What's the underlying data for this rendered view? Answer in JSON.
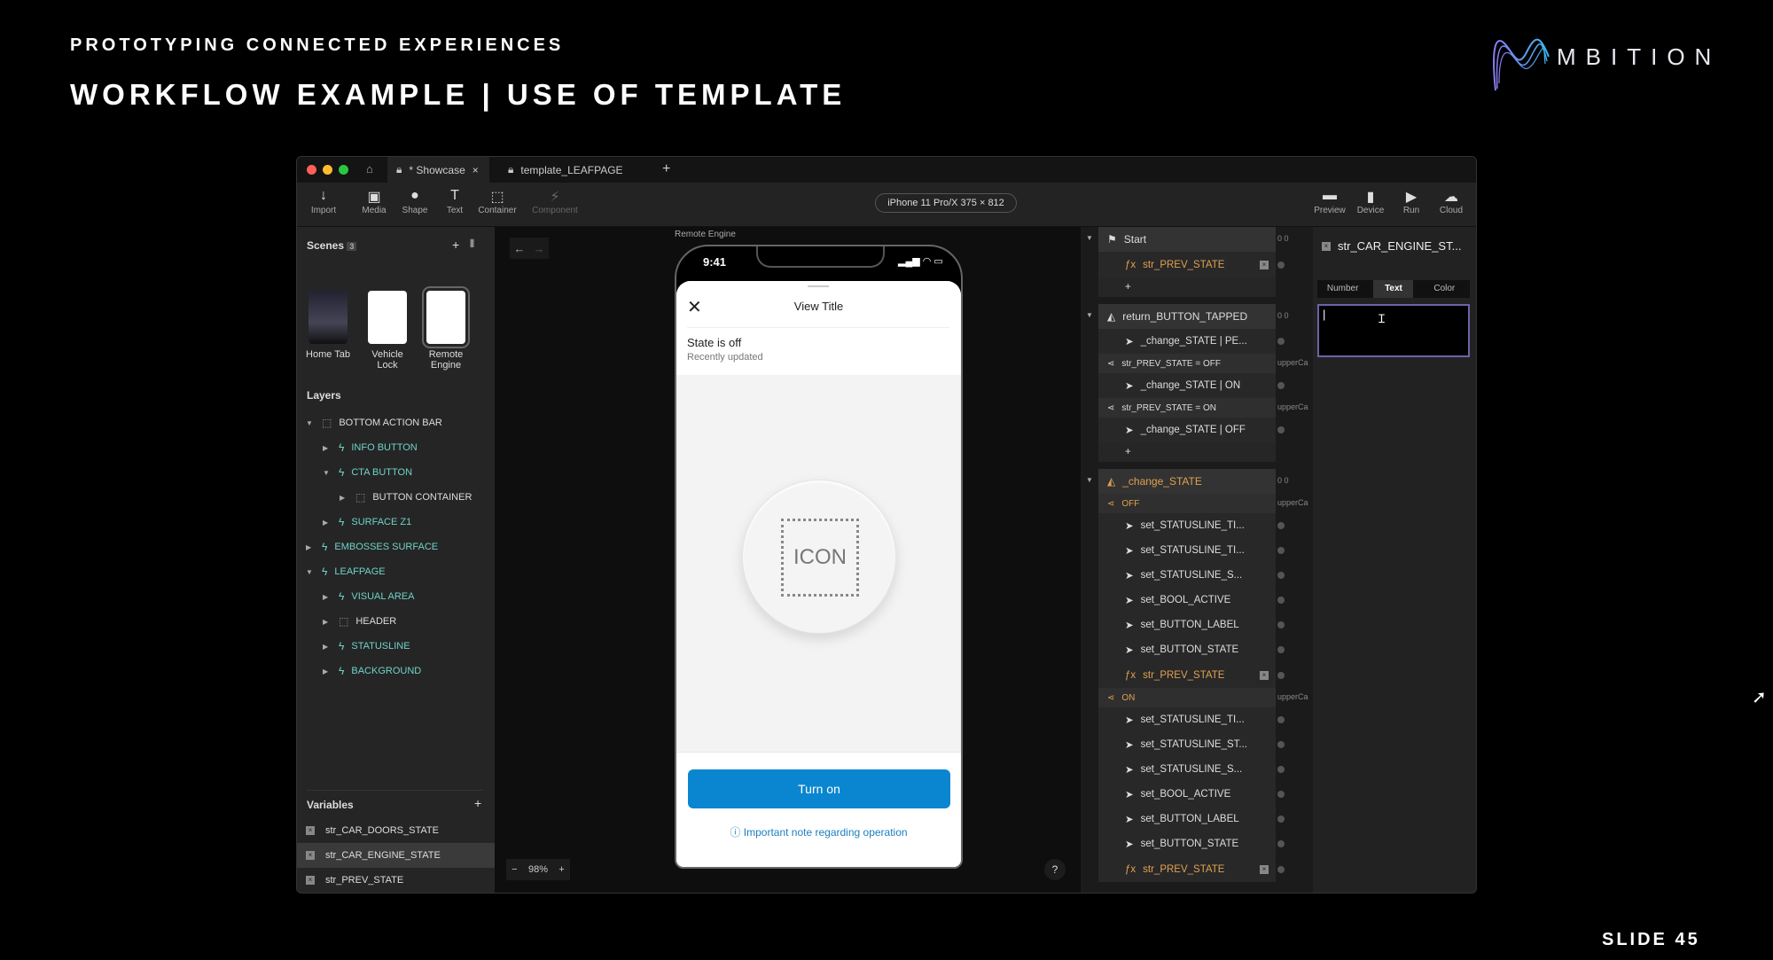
{
  "slide": {
    "kicker": "PROTOTYPING CONNECTED EXPERIENCES",
    "title": "WORKFLOW EXAMPLE | USE OF TEMPLATE",
    "logo_text": "MBITION",
    "number": "SLIDE 45"
  },
  "app": {
    "tabs": [
      {
        "label": "* Showcase",
        "close": "×"
      },
      {
        "label": "template_LEAFPAGE"
      }
    ],
    "new_tab": "+",
    "toolbar_left": [
      "Import",
      "Media",
      "Shape",
      "Text",
      "Container",
      "Component"
    ],
    "device": "iPhone 11 Pro/X  375 × 812",
    "toolbar_right": [
      "Preview",
      "Device",
      "Run",
      "Cloud"
    ],
    "scenes": {
      "title": "Scenes",
      "count": "3",
      "add": "+",
      "items": [
        "Home Tab",
        "Vehicle Lock",
        "Remote Engine"
      ]
    },
    "layers": {
      "title": "Layers",
      "items": [
        {
          "label": "BOTTOM ACTION BAR",
          "depth": 0,
          "kind": "container",
          "open": true
        },
        {
          "label": "INFO BUTTON",
          "depth": 1,
          "kind": "component",
          "open": false
        },
        {
          "label": "CTA BUTTON",
          "depth": 1,
          "kind": "component",
          "open": true
        },
        {
          "label": "BUTTON CONTAINER",
          "depth": 2,
          "kind": "container",
          "open": false
        },
        {
          "label": "SURFACE Z1",
          "depth": 1,
          "kind": "component",
          "open": false
        },
        {
          "label": "EMBOSSES SURFACE",
          "depth": 0,
          "kind": "component",
          "open": false
        },
        {
          "label": "LEAFPAGE",
          "depth": 0,
          "kind": "component",
          "open": true
        },
        {
          "label": "VISUAL AREA",
          "depth": 1,
          "kind": "component",
          "open": false
        },
        {
          "label": "HEADER",
          "depth": 1,
          "kind": "container",
          "open": false
        },
        {
          "label": "STATUSLINE",
          "depth": 1,
          "kind": "component",
          "open": false
        },
        {
          "label": "BACKGROUND",
          "depth": 1,
          "kind": "component",
          "open": false
        }
      ]
    },
    "variables": {
      "title": "Variables",
      "add": "+",
      "items": [
        "str_CAR_DOORS_STATE",
        "str_CAR_ENGINE_STATE",
        "str_PREV_STATE"
      ],
      "selected": 1
    },
    "canvas": {
      "scene_label": "Remote Engine",
      "zoom": "98%",
      "zoom_minus": "−",
      "zoom_plus": "+",
      "help": "?"
    },
    "phone": {
      "time": "9:41",
      "view_title": "View Title",
      "state": "State is off",
      "updated": "Recently updated",
      "icon_placeholder": "ICON",
      "button": "Turn on",
      "note": "Important note regarding operation",
      "accent": "#0a86d0"
    },
    "logic": [
      {
        "type": "hdr",
        "label": "Start",
        "icon": "flag",
        "side": "0    0"
      },
      {
        "type": "fx",
        "label": "str_PREV_STATE"
      },
      {
        "type": "plus",
        "label": "+"
      },
      {
        "type": "hdr",
        "label": "return_BUTTON_TAPPED",
        "icon": "trigger",
        "side": "0    0"
      },
      {
        "type": "action",
        "label": "_change_STATE | PE..."
      },
      {
        "type": "cond",
        "label": "str_PREV_STATE = OFF",
        "side": "upperCa"
      },
      {
        "type": "action",
        "label": "_change_STATE | ON"
      },
      {
        "type": "cond",
        "label": "str_PREV_STATE = ON",
        "side": "upperCa"
      },
      {
        "type": "action",
        "label": "_change_STATE | OFF"
      },
      {
        "type": "plus",
        "label": "+"
      },
      {
        "type": "hdr",
        "label": "_change_STATE",
        "icon": "trigger-orange",
        "side": "0    0"
      },
      {
        "type": "cond",
        "label": "OFF",
        "side": "upperCa",
        "orange": true
      },
      {
        "type": "action",
        "label": "set_STATUSLINE_TI..."
      },
      {
        "type": "action",
        "label": "set_STATUSLINE_TI..."
      },
      {
        "type": "action",
        "label": "set_STATUSLINE_S..."
      },
      {
        "type": "action",
        "label": "set_BOOL_ACTIVE"
      },
      {
        "type": "action",
        "label": "set_BUTTON_LABEL"
      },
      {
        "type": "action",
        "label": "set_BUTTON_STATE"
      },
      {
        "type": "fx",
        "label": "str_PREV_STATE"
      },
      {
        "type": "cond",
        "label": "ON",
        "side": "upperCa",
        "orange": true
      },
      {
        "type": "action",
        "label": "set_STATUSLINE_TI..."
      },
      {
        "type": "action",
        "label": "set_STATUSLINE_ST..."
      },
      {
        "type": "action",
        "label": "set_STATUSLINE_S..."
      },
      {
        "type": "action",
        "label": "set_BOOL_ACTIVE"
      },
      {
        "type": "action",
        "label": "set_BUTTON_LABEL"
      },
      {
        "type": "action",
        "label": "set_BUTTON_STATE"
      },
      {
        "type": "fx",
        "label": "str_PREV_STATE"
      }
    ],
    "inspector": {
      "title": "str_CAR_ENGINE_ST...",
      "types": [
        "Number",
        "Text",
        "Color"
      ],
      "selected_type": "Text",
      "value": ""
    }
  }
}
